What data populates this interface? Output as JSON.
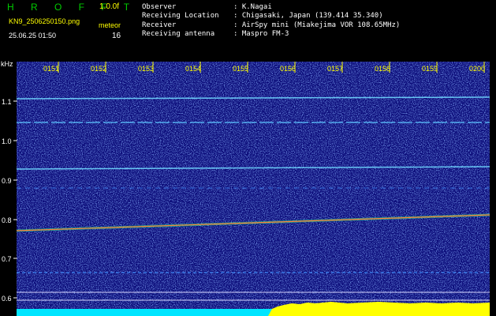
{
  "header": {
    "title": "H R O F F T",
    "version": "1.0.0f",
    "filename": "KN9_2506250150.png",
    "category": "meteor",
    "datetime": "25.06.25 01:50",
    "count": "16"
  },
  "info": {
    "rows": [
      {
        "key": "Observer",
        "value": ": K.Nagai"
      },
      {
        "key": "Receiving Location",
        "value": ": Chigasaki, Japan (139.414 35.340)"
      },
      {
        "key": "Receiver",
        "value": ": AirSpy mini (Miakejima VOR 108.65MHz)"
      },
      {
        "key": "Receiving antenna",
        "value": ": Maspro FM-3"
      }
    ]
  },
  "axis": {
    "y_unit": "kHz",
    "y_ticks": [
      "1.1",
      "1.0",
      "0.9",
      "0.8",
      "0.7",
      "0.6"
    ],
    "x_ticks": [
      "0151",
      "0152",
      "0153",
      "0154",
      "0155",
      "0156",
      "0157",
      "0158",
      "0159",
      "0200"
    ]
  },
  "colors": {
    "background": "#000000",
    "spectrogram_base": "#0a0a78",
    "axis_labels": "#ffff00",
    "header_title": "#00cc00",
    "signal_trace": "#ff7a3a",
    "level_bar": "#ffff00",
    "baseline_bar": "#00e5ff"
  }
}
